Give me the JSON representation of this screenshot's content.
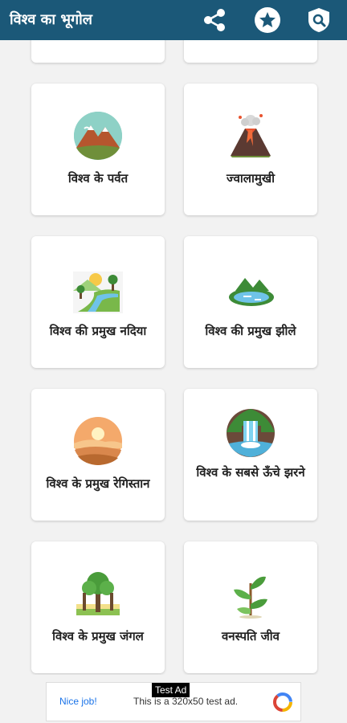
{
  "app_bar": {
    "title": "विश्व का भूगोल",
    "icons": [
      "share-icon",
      "star-icon",
      "privacy-shield-icon"
    ]
  },
  "cards": [
    {
      "label": "विश्व के पर्वत",
      "icon": "mountain-icon"
    },
    {
      "label": "ज्वालामुखी",
      "icon": "volcano-icon"
    },
    {
      "label": "विश्व की प्रमुख नदिया",
      "icon": "river-icon"
    },
    {
      "label": "विश्व की प्रमुख झीले",
      "icon": "lake-icon"
    },
    {
      "label": "विश्व के प्रमुख रेगिस्तान",
      "icon": "desert-icon"
    },
    {
      "label": "विश्व के सबसे ऊँचे झरने",
      "icon": "waterfall-icon"
    },
    {
      "label": "विश्व के प्रमुख जंगल",
      "icon": "forest-icon"
    },
    {
      "label": "वनस्पति जीव",
      "icon": "plant-icon"
    }
  ],
  "ad": {
    "tag": "Test Ad",
    "cta": "Nice job!",
    "text": "This is a 320x50 test ad."
  },
  "colors": {
    "app_bar": "#1b5878",
    "background": "#f2f2f2"
  }
}
